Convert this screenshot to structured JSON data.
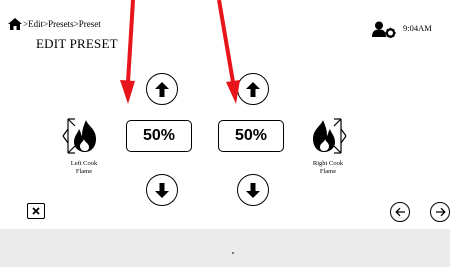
{
  "header": {
    "breadcrumb": ">Edit>Presets>Preset",
    "title": "EDIT PRESET",
    "time": "9:04AM"
  },
  "left": {
    "value": "50%",
    "label_line1": "Left Cook",
    "label_line2": "Flame"
  },
  "right": {
    "value": "50%",
    "label_line1": "Right Cook",
    "label_line2": "Flame"
  },
  "footer": {
    "text": "."
  },
  "icons": [
    "home-icon",
    "user-settings-icon",
    "arrow-up-icon",
    "arrow-down-icon",
    "flame-icon",
    "close-icon",
    "arrow-left-icon",
    "arrow-right-icon"
  ],
  "colors": {
    "annotation_arrow": "#e8141b",
    "footer_bg": "#ebebeb"
  }
}
